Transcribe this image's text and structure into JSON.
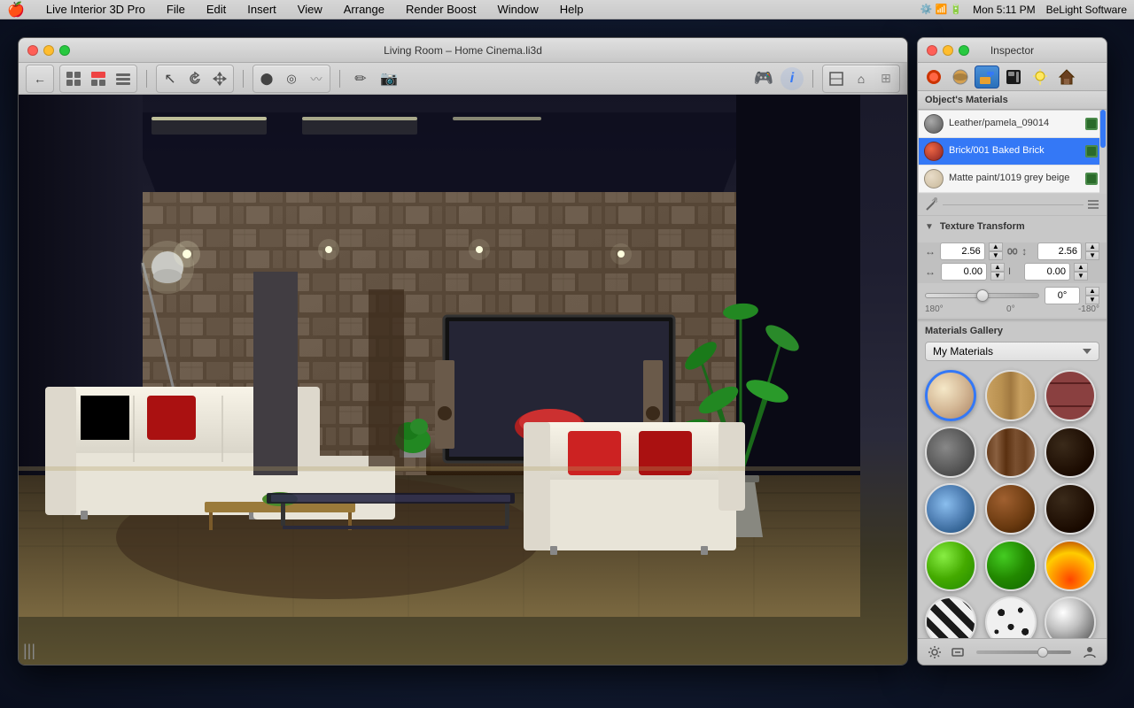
{
  "menubar": {
    "apple": "🍎",
    "items": [
      "Live Interior 3D Pro",
      "File",
      "Edit",
      "Insert",
      "View",
      "Arrange",
      "Render Boost",
      "Window",
      "Help"
    ],
    "right": {
      "status_icons": "⚙️📶🔋",
      "time": "Mon 5:11 PM",
      "brand": "BeLight Software"
    }
  },
  "main_window": {
    "title": "Living Room – Home Cinema.li3d",
    "traffic_lights": {
      "close": "close",
      "minimize": "minimize",
      "maximize": "maximize"
    }
  },
  "toolbar": {
    "back_btn": "←",
    "layout_btn1": "⊞",
    "layout_btn2": "⊟",
    "layout_btn3": "≡",
    "select_tool": "↖",
    "rotate_tool": "↻",
    "move_tool": "⊕",
    "draw_circle": "⬤",
    "draw_rect": "◎",
    "freeform": "〰",
    "pen_tool": "✏",
    "camera_tool": "📷",
    "render_btn": "🎮",
    "info_btn": "ℹ",
    "view1": "⊡",
    "view2": "⌂",
    "view3": "⊞"
  },
  "inspector": {
    "title": "Inspector",
    "tabs": [
      {
        "id": "materials_tab",
        "icon": "🔴",
        "active": false
      },
      {
        "id": "sphere_tab",
        "icon": "⚪",
        "active": false
      },
      {
        "id": "paint_tab",
        "icon": "🖌",
        "active": true
      },
      {
        "id": "texture_tab",
        "icon": "⬛",
        "active": false
      },
      {
        "id": "light_tab",
        "icon": "💡",
        "active": false
      },
      {
        "id": "house_tab",
        "icon": "🏠",
        "active": false
      }
    ],
    "objects_materials_label": "Object's Materials",
    "materials": [
      {
        "id": "leather_pamela",
        "name": "Leather/pamela_09014",
        "swatch_color": "#888888",
        "icon": "🔲"
      },
      {
        "id": "brick_baked",
        "name": "Brick/001 Baked Brick",
        "swatch_color": "#cc4422",
        "icon": "🔲",
        "selected": true
      },
      {
        "id": "matte_paint",
        "name": "Matte paint/1019 grey beige",
        "swatch_color": "#d4c8b4",
        "icon": "🔲"
      }
    ],
    "texture_transform": {
      "label": "Texture Transform",
      "h_scale": "2.56",
      "v_scale": "2.56",
      "h_offset": "0.00",
      "v_offset": "0.00",
      "rotation": "0°",
      "slider_min": "180°",
      "slider_center": "0°",
      "slider_max": "-180°"
    },
    "materials_gallery": {
      "label": "Materials Gallery",
      "dropdown_label": "My Materials",
      "items": [
        {
          "id": "mat_beige",
          "class": "mat-beige",
          "selected": true
        },
        {
          "id": "mat_wood_light",
          "class": "mat-wood-light"
        },
        {
          "id": "mat_brick",
          "class": "mat-brick"
        },
        {
          "id": "mat_stone_grey",
          "class": "mat-stone-grey"
        },
        {
          "id": "mat_wood_brown",
          "class": "mat-wood-brown"
        },
        {
          "id": "mat_dark",
          "class": "mat-dark"
        },
        {
          "id": "mat_water",
          "class": "mat-water"
        },
        {
          "id": "mat_sphere_brown",
          "class": "mat-sphere-brown"
        },
        {
          "id": "mat_sphere_dark",
          "class": "mat-sphere-dark"
        },
        {
          "id": "mat_green_bright",
          "class": "mat-green-bright"
        },
        {
          "id": "mat_green_mid",
          "class": "mat-green-mid"
        },
        {
          "id": "mat_fire",
          "class": "mat-fire"
        },
        {
          "id": "mat_zebra",
          "class": "mat-zebra"
        },
        {
          "id": "mat_spots",
          "class": "mat-spots"
        },
        {
          "id": "mat_silver",
          "class": "mat-silver"
        }
      ]
    }
  },
  "viewport": {
    "scroll_indicator": "|||"
  }
}
